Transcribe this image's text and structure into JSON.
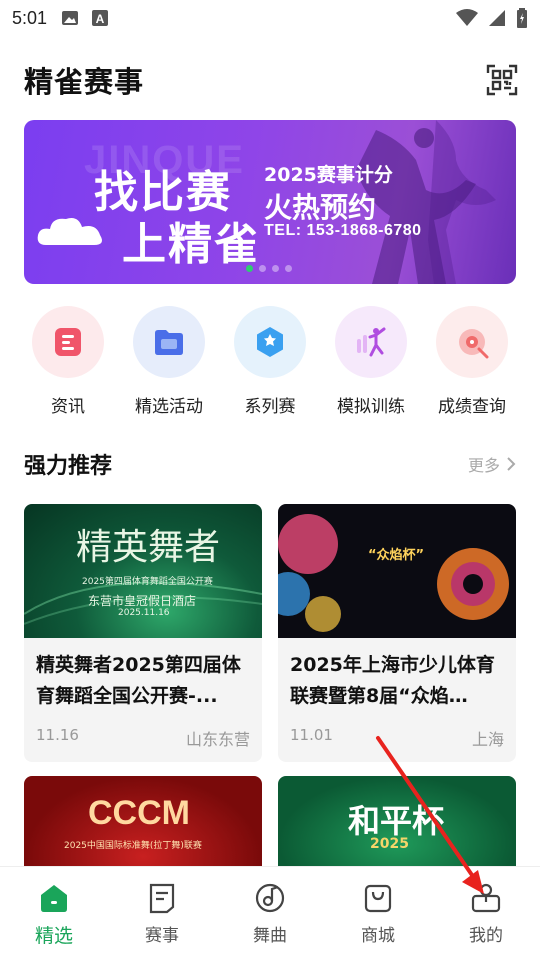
{
  "status_bar": {
    "time": "5:01"
  },
  "header": {
    "title": "精雀赛事",
    "qr_icon": "qr-scan-icon"
  },
  "banner": {
    "watermark": "JINQUE",
    "line1": "找比赛",
    "line2": "上精雀",
    "sub1": "2025赛事计分",
    "sub2": "火热预约",
    "phone": "TEL: 153-1868-6780",
    "dot_count": 4,
    "active_dot": 0
  },
  "quick_nav": [
    {
      "label": "资讯",
      "icon": "news-icon",
      "color": "#f0556a",
      "bg": "#fdeaec"
    },
    {
      "label": "精选活动",
      "icon": "folder-icon",
      "color": "#4a6ee8",
      "bg": "#e6edfb"
    },
    {
      "label": "系列赛",
      "icon": "series-badge-icon",
      "color": "#3aa0f0",
      "bg": "#e5f2fc"
    },
    {
      "label": "模拟训练",
      "icon": "dancer-icon",
      "color": "#b04de0",
      "bg": "#f6e9fb"
    },
    {
      "label": "成绩查询",
      "icon": "record-icon",
      "color": "#f06a6a",
      "bg": "#fdecec"
    }
  ],
  "section": {
    "title": "强力推荐",
    "more": "更多"
  },
  "cards": [
    {
      "title": "精英舞者2025第四届体育舞蹈全国公开赛-...",
      "date": "11.16",
      "location": "山东东营",
      "img_title": "精英舞者",
      "img_sub": "2025第四届体育舞蹈全国公开赛",
      "img_venue": "东营市皇冠假日酒店",
      "img_date": "2025.11.16"
    },
    {
      "title": "2025年上海市少儿体育联赛暨第8届“众焰…",
      "date": "11.01",
      "location": "上海",
      "img_cup": "“众焰杯”"
    },
    {
      "img_title": "CCCM",
      "img_sub": "2025中国国际标准舞(拉丁舞)联赛"
    },
    {
      "img_title": "和平杯",
      "img_sub": "2025"
    }
  ],
  "bottom_nav": [
    {
      "label": "精选",
      "icon": "home-icon",
      "active": true
    },
    {
      "label": "赛事",
      "icon": "document-icon",
      "active": false
    },
    {
      "label": "舞曲",
      "icon": "music-disc-icon",
      "active": false
    },
    {
      "label": "商城",
      "icon": "shopping-bag-icon",
      "active": false
    },
    {
      "label": "我的",
      "icon": "profile-icon",
      "active": false
    }
  ],
  "colors": {
    "accent": "#1aa55a",
    "annotation_arrow": "#e8231e"
  }
}
